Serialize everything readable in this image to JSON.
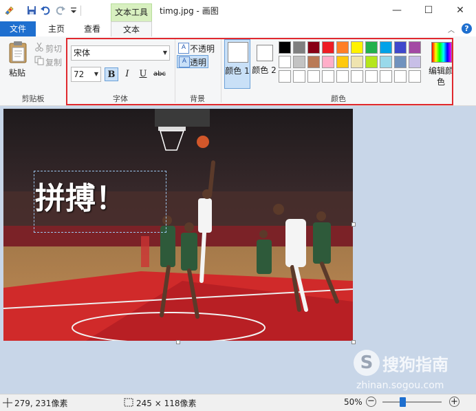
{
  "title_bar": {
    "context_tab_label": "文本工具",
    "window_title": "timg.jpg - 画图",
    "minimize_glyph": "—",
    "maximize_glyph": "☐",
    "close_glyph": "✕"
  },
  "tabs": {
    "file": "文件",
    "home": "主页",
    "view": "查看",
    "text": "文本"
  },
  "clipboard": {
    "paste": "粘贴",
    "cut": "剪切",
    "copy": "复制",
    "group": "剪贴板"
  },
  "font": {
    "family": "宋体",
    "size": "72",
    "bold": "B",
    "italic": "I",
    "underline": "U",
    "strikethrough": "abc",
    "group": "字体"
  },
  "background": {
    "opaque": "不透明",
    "transparent": "透明",
    "group": "背景"
  },
  "colors": {
    "color1_label": "颜色 1",
    "color2_label": "颜色 2",
    "edit_colors_label": "编辑颜色",
    "group": "颜色",
    "color1_value": "#ffffff",
    "color2_value": "#ffffff",
    "palette_row1": [
      "#000000",
      "#7f7f7f",
      "#880015",
      "#ed1c24",
      "#ff7f27",
      "#fff200",
      "#22b14c",
      "#00a2e8",
      "#3f48cc",
      "#a349a4"
    ],
    "palette_row2": [
      "#ffffff",
      "#c3c3c3",
      "#b97a57",
      "#ffaec9",
      "#ffc90e",
      "#efe4b0",
      "#b5e61d",
      "#99d9ea",
      "#7092be",
      "#c8bfe7"
    ],
    "palette_row3": [
      "#ffffff",
      "#ffffff",
      "#ffffff",
      "#ffffff",
      "#ffffff",
      "#ffffff",
      "#ffffff",
      "#ffffff",
      "#ffffff",
      "#ffffff"
    ]
  },
  "canvas": {
    "overlay_text": "拼搏！"
  },
  "watermark": {
    "brand": "搜狗指南",
    "url": "zhinan.sogou.com"
  },
  "status": {
    "cursor_pos": "279, 231像素",
    "selection_size": "245 × 118像素",
    "zoom": "50%",
    "zoom_level": 0.5
  }
}
